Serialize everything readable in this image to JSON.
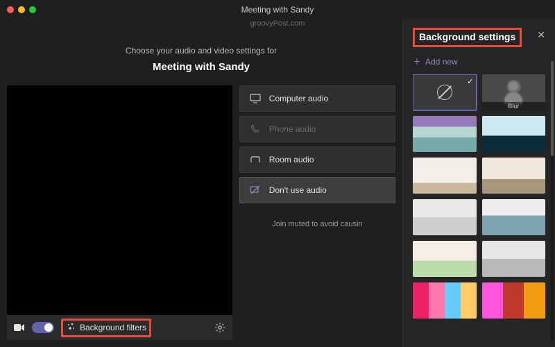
{
  "watermark": "groovyPost.com",
  "titlebar": {
    "title": "Meeting with Sandy"
  },
  "prompt": "Choose your audio and video settings for",
  "meeting_name": "Meeting with Sandy",
  "controls": {
    "camera_on": true,
    "background_filters_label": "Background filters"
  },
  "audio_options": [
    {
      "label": "Computer audio",
      "state": "enabled"
    },
    {
      "label": "Phone audio",
      "state": "disabled"
    },
    {
      "label": "Room audio",
      "state": "enabled"
    },
    {
      "label": "Don't use audio",
      "state": "selected"
    }
  ],
  "join_note": "Join muted to avoid causin",
  "panel": {
    "title": "Background settings",
    "add_new": "Add new",
    "thumbs": [
      {
        "kind": "none",
        "selected": true
      },
      {
        "kind": "blur",
        "label": "Blur"
      },
      {
        "kind": "image",
        "cls": "bg-a"
      },
      {
        "kind": "image",
        "cls": "bg-b"
      },
      {
        "kind": "image",
        "cls": "bg-c"
      },
      {
        "kind": "image",
        "cls": "bg-d"
      },
      {
        "kind": "image",
        "cls": "bg-e"
      },
      {
        "kind": "image",
        "cls": "bg-f"
      },
      {
        "kind": "image",
        "cls": "bg-g"
      },
      {
        "kind": "image",
        "cls": "bg-h"
      },
      {
        "kind": "image",
        "cls": "bg-i"
      },
      {
        "kind": "image",
        "cls": "bg-j"
      }
    ]
  }
}
